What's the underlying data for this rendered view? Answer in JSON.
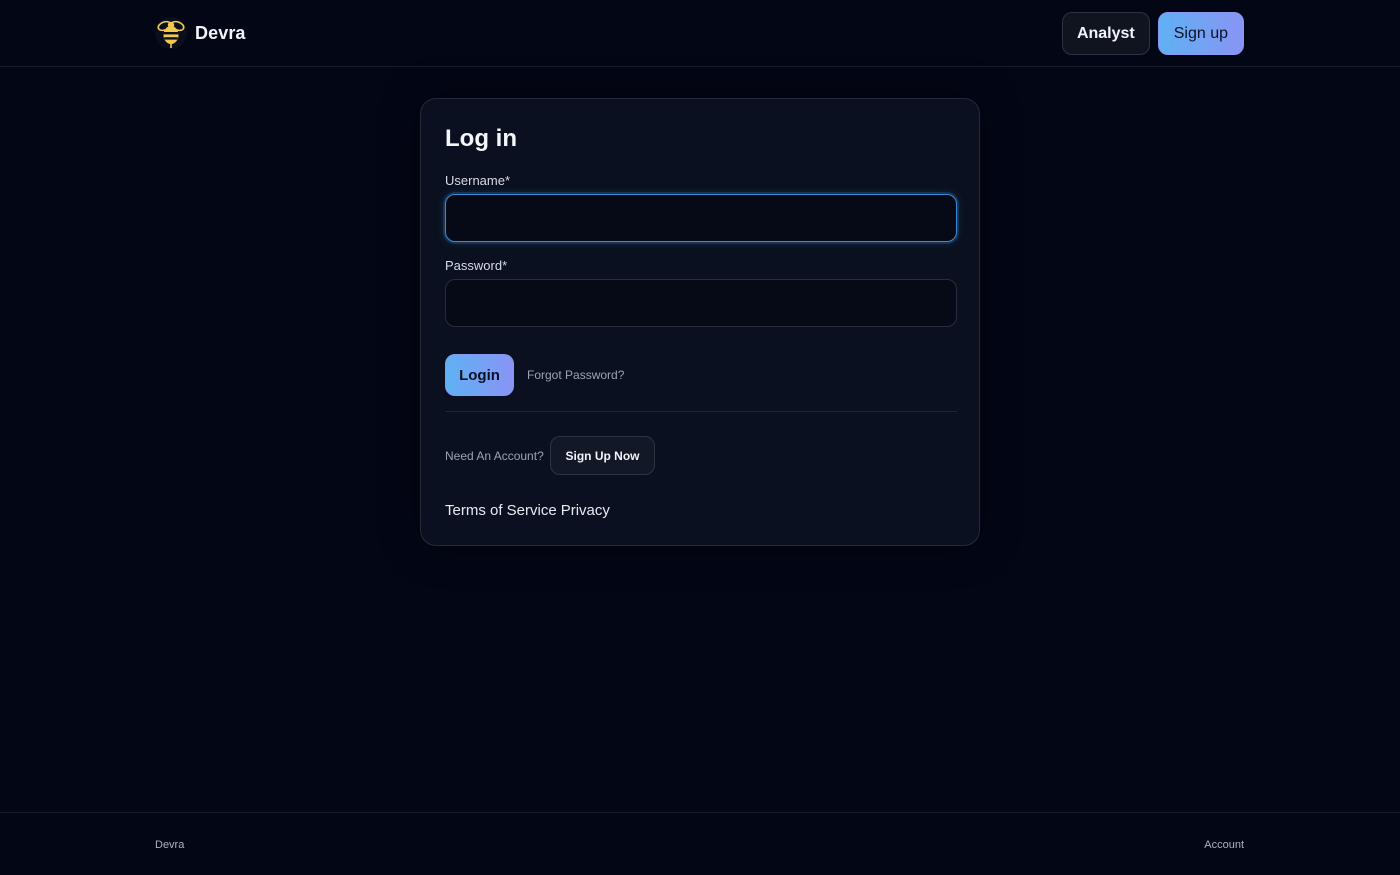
{
  "header": {
    "brand": {
      "name": "Devra",
      "logo_icon": "bee-icon",
      "logo_color": "#f2c94c"
    },
    "analyst_label": "Analyst",
    "signup_label": "Sign up"
  },
  "login_card": {
    "title": "Log in",
    "username": {
      "label": "Username*",
      "value": "",
      "placeholder": ""
    },
    "password": {
      "label": "Password*",
      "value": "",
      "placeholder": ""
    },
    "login_label": "Login",
    "forgot_password_label": "Forgot Password?",
    "need_account_text": "Need An Account?",
    "signup_now_label": "Sign Up Now",
    "terms_label": "Terms of Service",
    "privacy_label": "Privacy"
  },
  "footer": {
    "brand_label": "Devra",
    "account_label": "Account"
  },
  "colors": {
    "background": "#030615",
    "card": "#0a101f",
    "accent_gradient_start": "#5fb1f3",
    "accent_gradient_end": "#8894f5",
    "focus_ring": "#3a8ad6"
  }
}
